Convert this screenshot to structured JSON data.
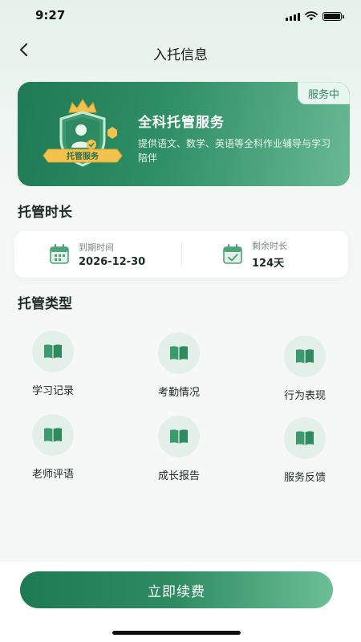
{
  "status_bar": {
    "time": "9:27"
  },
  "nav": {
    "title": "入托信息"
  },
  "banner": {
    "badge": "服务中",
    "emblem_label": "托管服务",
    "title": "全科托管服务",
    "description": "提供语文、数学、英语等全科作业辅导与学习陪伴"
  },
  "duration": {
    "title": "托管时长",
    "expire_label": "到期时间",
    "expire_value": "2026-12-30",
    "remaining_label": "剩余时长",
    "remaining_value": "124天"
  },
  "types": {
    "title": "托管类型",
    "items": [
      {
        "label": "学习记录",
        "icon": "book-icon"
      },
      {
        "label": "考勤情况",
        "icon": "book-icon"
      },
      {
        "label": "行为表现",
        "icon": "book-icon"
      },
      {
        "label": "老师评语",
        "icon": "book-icon"
      },
      {
        "label": "成长报告",
        "icon": "book-icon"
      },
      {
        "label": "服务反馈",
        "icon": "book-icon"
      }
    ]
  },
  "footer": {
    "renew_label": "立即续费"
  },
  "colors": {
    "primary": "#2f8c62",
    "primary_dark": "#1d7a52",
    "light": "#e3f0e9"
  }
}
